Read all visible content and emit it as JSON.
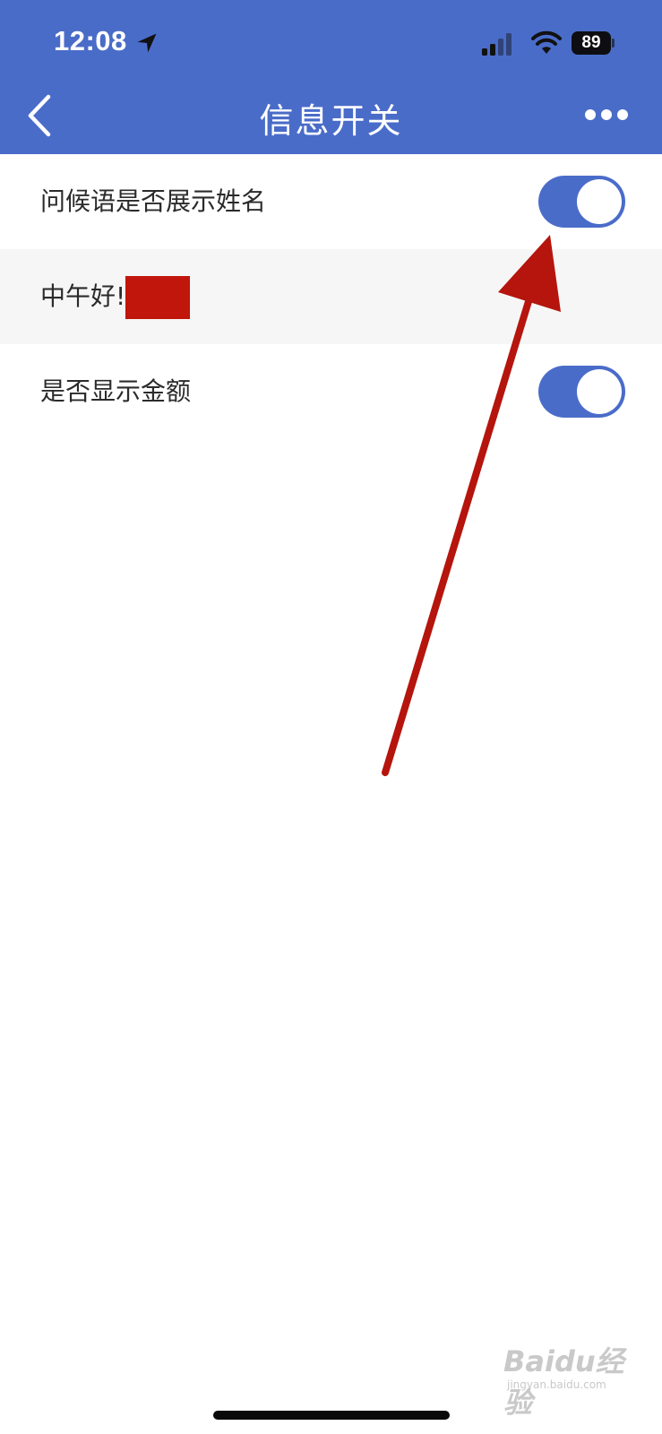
{
  "status_bar": {
    "time": "12:08",
    "battery": "89",
    "icons": [
      "location-arrow-icon",
      "cellular-signal-icon",
      "wifi-icon",
      "battery-icon"
    ]
  },
  "header": {
    "title": "信息开关",
    "back_icon": "chevron-left-icon",
    "more_icon": "more-horizontal-icon",
    "background_color": "#4a6cc9"
  },
  "settings": [
    {
      "label": "问候语是否展示姓名",
      "toggle_on": true
    },
    {
      "label": "中午好!",
      "type": "preview",
      "redacted": true
    },
    {
      "label": "是否显示金额",
      "toggle_on": true
    }
  ],
  "colors": {
    "accent": "#4a6cc9",
    "annotation_arrow": "#b5150d",
    "redaction": "#c0160c"
  },
  "watermark": {
    "text": "Baidu经验",
    "sub": "jingyan.baidu.com"
  }
}
